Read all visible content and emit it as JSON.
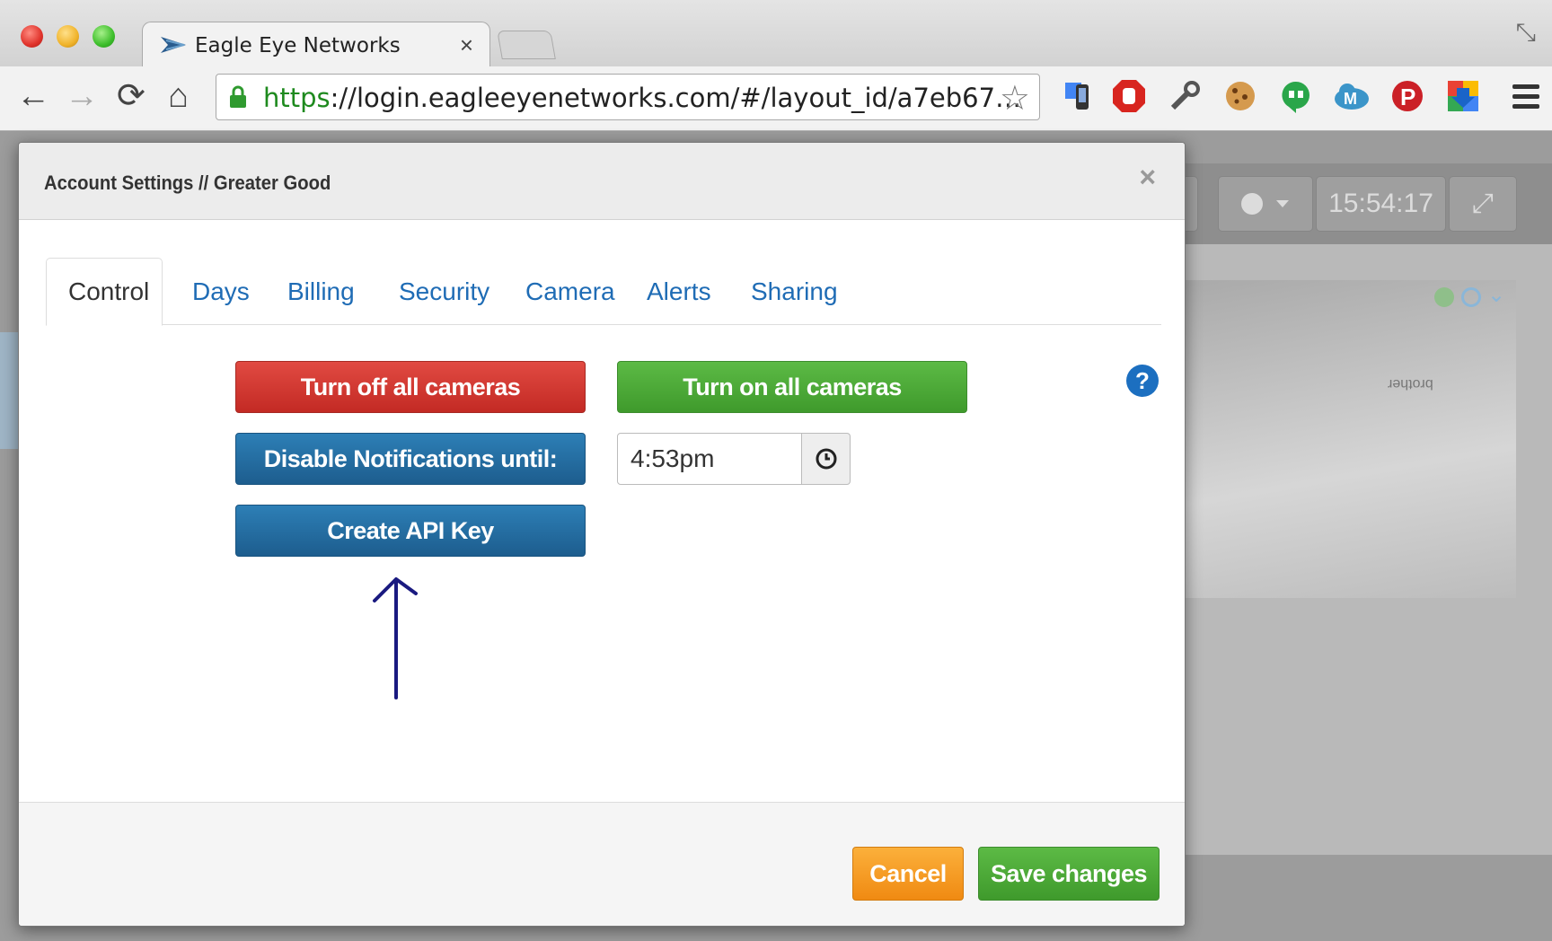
{
  "browser": {
    "tab_title": "Eagle Eye Networks",
    "tab_close": "×",
    "url_scheme": "https",
    "url_rest": "://login.eagleeyenetworks.com/#/layout_id/a7eb67…",
    "nav": {
      "back": "←",
      "forward": "→",
      "reload": "⟳",
      "home": "⌂",
      "star": "☆",
      "fullscreen": "⤡"
    },
    "extensions": [
      {
        "name": "google-voice-icon",
        "color": "#444"
      },
      {
        "name": "adblock-icon",
        "color": "#d8251f"
      },
      {
        "name": "wrench-icon",
        "color": "#555"
      },
      {
        "name": "cookie-icon",
        "color": "#c8883a"
      },
      {
        "name": "hangouts-icon",
        "color": "#2aa64a"
      },
      {
        "name": "m-cloud-icon",
        "color": "#3b95c9"
      },
      {
        "name": "pinterest-icon",
        "color": "#cb2027"
      },
      {
        "name": "download-icon",
        "color": "#3a85d0"
      }
    ]
  },
  "background_page": {
    "clock": "15:54:17",
    "camera_brand": "brother"
  },
  "modal": {
    "title": "Account Settings // Greater Good",
    "close": "×",
    "tabs": [
      {
        "label": "Control",
        "active": true
      },
      {
        "label": "Days",
        "active": false
      },
      {
        "label": "Billing",
        "active": false
      },
      {
        "label": "Security",
        "active": false
      },
      {
        "label": "Camera",
        "active": false
      },
      {
        "label": "Alerts",
        "active": false
      },
      {
        "label": "Sharing",
        "active": false
      }
    ],
    "controls": {
      "turn_off": "Turn off all cameras",
      "turn_on": "Turn on all cameras",
      "disable_notifications": "Disable Notifications until:",
      "time_value": "4:53pm",
      "create_api_key": "Create API Key",
      "help": "?"
    },
    "footer": {
      "cancel": "Cancel",
      "save": "Save changes"
    }
  },
  "colors": {
    "red": "#d8332c",
    "green": "#4caa36",
    "blue": "#236c9f",
    "orange": "#f39c1e",
    "link": "#1f6cb5",
    "annotation": "#1a1a80"
  }
}
